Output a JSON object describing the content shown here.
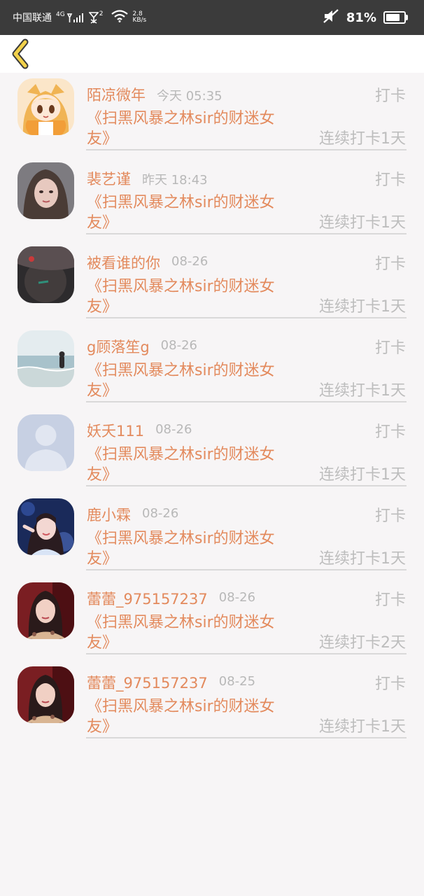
{
  "status_bar": {
    "carrier": "中国联通",
    "network": "4G",
    "sim2": "2",
    "speed_value": "2.8",
    "speed_unit": "KB/s",
    "battery": "81%",
    "battery_level": 0.81
  },
  "header": {
    "back_icon": "chevron-left-icon",
    "accent_color": "#f2d14a"
  },
  "book_title_line1": "《扫黑风暴之林sir的财迷女",
  "book_title_line2": "友》",
  "entries": [
    {
      "name": "陌凉微年",
      "time": "今天 05:35",
      "action": "打卡",
      "streak": "连续打卡1天",
      "avatar": "anime-girl"
    },
    {
      "name": "裴艺谨",
      "time": "昨天 18:43",
      "action": "打卡",
      "streak": "连续打卡1天",
      "avatar": "portrait-dark"
    },
    {
      "name": "被看谁的你",
      "time": "08-26",
      "action": "打卡",
      "streak": "连续打卡1天",
      "avatar": "dark-photo"
    },
    {
      "name": "g顾落笙g",
      "time": "08-26",
      "action": "打卡",
      "streak": "连续打卡1天",
      "avatar": "beach"
    },
    {
      "name": "妖夭111",
      "time": "08-26",
      "action": "打卡",
      "streak": "连续打卡1天",
      "avatar": "default-user"
    },
    {
      "name": "鹿小霖",
      "time": "08-26",
      "action": "打卡",
      "streak": "连续打卡1天",
      "avatar": "portrait-blue"
    },
    {
      "name": "蕾蕾_975157237",
      "time": "08-26",
      "action": "打卡",
      "streak": "连续打卡2天",
      "avatar": "portrait-red"
    },
    {
      "name": "蕾蕾_975157237",
      "time": "08-25",
      "action": "打卡",
      "streak": "连续打卡1天",
      "avatar": "portrait-red"
    }
  ]
}
